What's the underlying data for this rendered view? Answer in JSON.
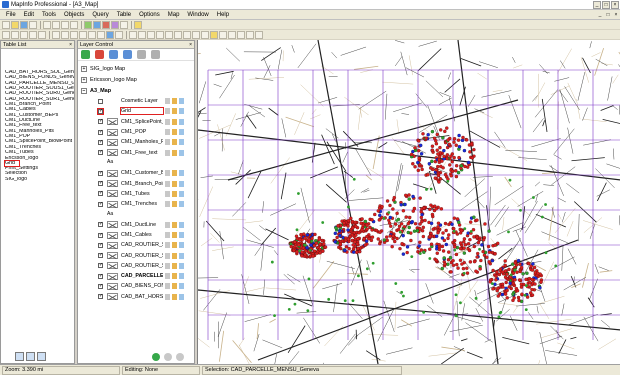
{
  "window": {
    "title": "MapInfo Professional - [A3_Map]",
    "controls": [
      "_",
      "□",
      "×"
    ]
  },
  "menu": [
    "File",
    "Edit",
    "Tools",
    "Objects",
    "Query",
    "Table",
    "Options",
    "Map",
    "Window",
    "Help"
  ],
  "table_list": {
    "title": "Table List",
    "items": [
      "CAD_BAT_HORS_SOL_Geneva",
      "CAD_BIENS_FONDS_Geneva",
      "CAD_PARCELLE_MENSU_Gene",
      "CAD_ROUTIER_SOUS1_Geneva",
      "CAD_ROUTIER_SUR0_Geneva",
      "CAD_ROUTIER_SUR1_Geneva",
      "CM1_Branch_Point",
      "CM1_Cables",
      "CM1_Customer_BEPs",
      "CM1_DuctLine",
      "CM1_Free_text",
      "CM1_Manholes_Pits",
      "CM1_POP",
      "CM1_SplicePoint_BlowPoint",
      "CM1_Trenches",
      "CM1_Tubes",
      "Ericsson_logo",
      "Grid",
      "Print_Settings",
      "Selection",
      "SIG_logo"
    ],
    "selected_index": 17
  },
  "layer_control": {
    "title": "Layer Control",
    "maps": [
      {
        "label": "SIG_logo Map",
        "expanded": false
      },
      {
        "label": "Ericsson_logo Map",
        "expanded": false
      },
      {
        "label": "A3_Map",
        "expanded": true
      }
    ],
    "layers": [
      {
        "name": "Cosmetic Layer",
        "checked": false,
        "style": "none"
      },
      {
        "name": "Grid",
        "checked": true,
        "style": "none",
        "highlighted": true
      },
      {
        "name": "CM1_SplicePoint_E",
        "checked": true,
        "style": "cross"
      },
      {
        "name": "CM1_POP",
        "checked": true,
        "style": "cross"
      },
      {
        "name": "CM1_Manholes_Pi",
        "checked": true,
        "style": "cross"
      },
      {
        "name": "CM1_Free_text",
        "checked": true,
        "style": "cross"
      },
      {
        "name": "Aa",
        "checked": null,
        "style": "aa"
      },
      {
        "name": "CM1_Customer_Bl",
        "checked": true,
        "style": "cross"
      },
      {
        "name": "CM1_Branch_Poin",
        "checked": true,
        "style": "cross"
      },
      {
        "name": "CM1_Tubes",
        "checked": true,
        "style": "cross"
      },
      {
        "name": "CM1_Trenches",
        "checked": true,
        "style": "cross"
      },
      {
        "name": "Aa",
        "checked": null,
        "style": "aa"
      },
      {
        "name": "CM1_DuctLine",
        "checked": true,
        "style": "cross"
      },
      {
        "name": "CM1_Cables",
        "checked": true,
        "style": "cross"
      },
      {
        "name": "CAD_ROUTIER_SUS",
        "checked": true,
        "style": "cross"
      },
      {
        "name": "CAD_ROUTIER_SUS",
        "checked": true,
        "style": "cross"
      },
      {
        "name": "CAD_ROUTIER_SO",
        "checked": true,
        "style": "cross"
      },
      {
        "name": "CAD_PARCELLE_",
        "checked": true,
        "style": "cross",
        "bold": true
      },
      {
        "name": "CAD_BIENS_FONE",
        "checked": true,
        "style": "cross"
      },
      {
        "name": "CAD_BAT_HORS_",
        "checked": true,
        "style": "cross"
      }
    ]
  },
  "map": {
    "colors": {
      "grid": "#7b32c8",
      "network": "#d81e1e",
      "customer": "#2f9e2f",
      "pop": "#1a2bd8",
      "parcel": "#c8b28a"
    }
  },
  "status": {
    "zoom": "Zoom: 3.390 mi",
    "editing": "Editing: None",
    "selection": "Selection: CAD_PARCELLE_MENSU_Geneva"
  }
}
